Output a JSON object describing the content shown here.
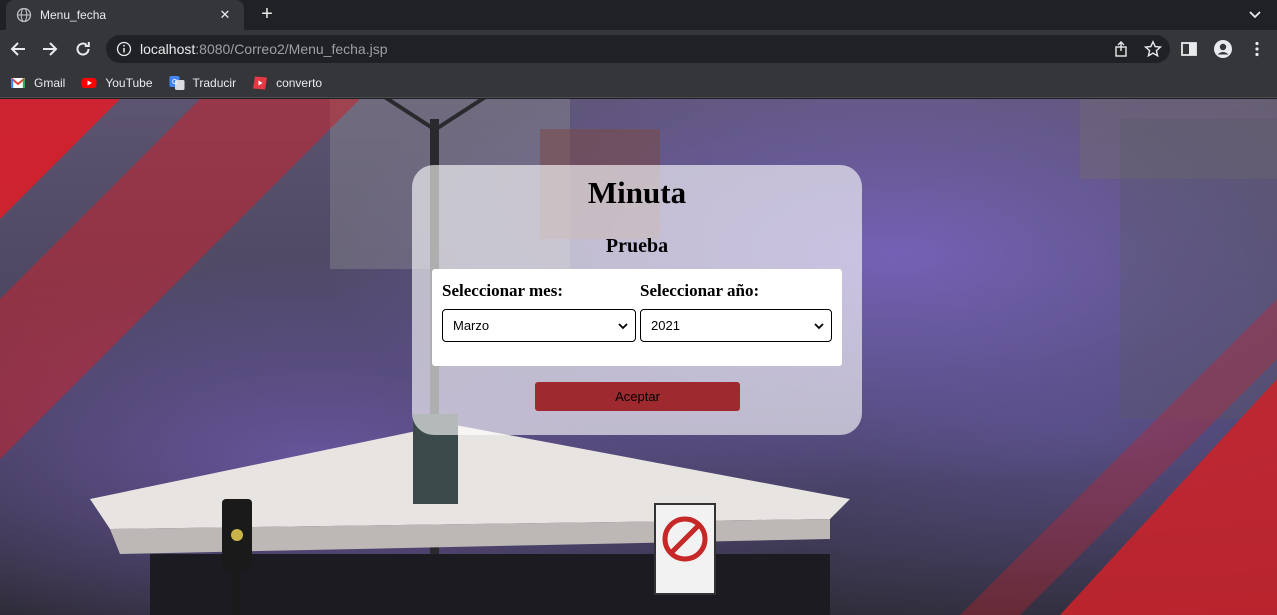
{
  "browser": {
    "tab": {
      "title": "Menu_fecha",
      "close_label": "✕"
    },
    "new_tab_label": "+",
    "url": {
      "host": "localhost",
      "rest": ":8080/Correo2/Menu_fecha.jsp"
    },
    "bookmarks": [
      {
        "label": "Gmail",
        "icon": "gmail-icon"
      },
      {
        "label": "YouTube",
        "icon": "youtube-icon"
      },
      {
        "label": "Traducir",
        "icon": "translate-icon"
      },
      {
        "label": "converto",
        "icon": "converto-icon"
      }
    ]
  },
  "page": {
    "title": "Minuta",
    "subtitle": "Prueba",
    "month": {
      "label": "Seleccionar mes:",
      "value": "Marzo"
    },
    "year": {
      "label": "Seleccionar año:",
      "value": "2021"
    },
    "accept_label": "Aceptar"
  },
  "colors": {
    "accent": "#9e2a2f",
    "chrome_dark": "#202124",
    "chrome_mid": "#35363a"
  }
}
